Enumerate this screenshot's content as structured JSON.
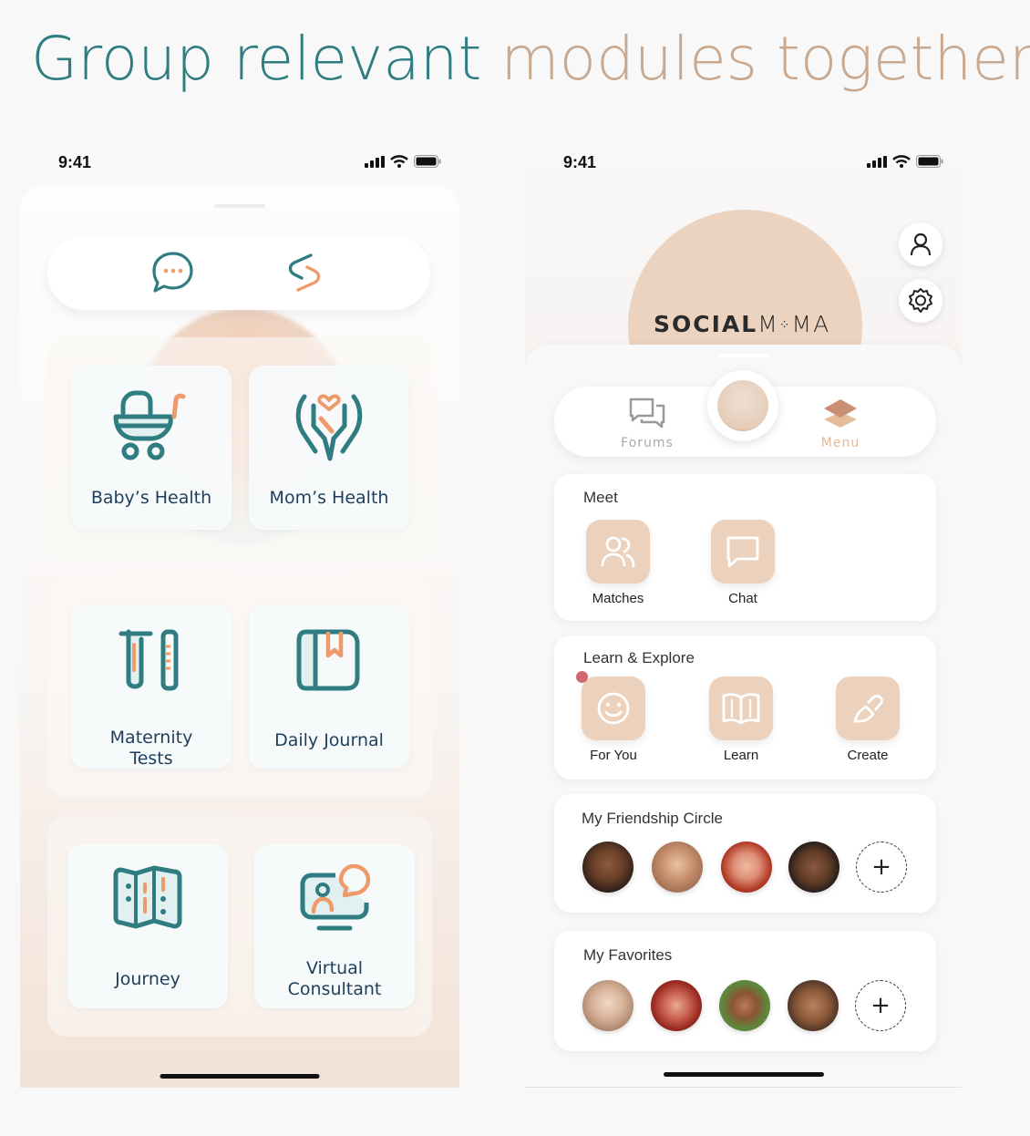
{
  "headline": {
    "part1": "Group relevant",
    "part2": "modules together"
  },
  "colors": {
    "teal": "#2f7d80",
    "tan": "#c8a98f",
    "peach": "#ecd2bd",
    "orange": "#ef9a6a",
    "navy": "#1f3e5c",
    "notification_dot": "#d06a70"
  },
  "left_phone": {
    "status_time": "9:41",
    "top_bar_icons": [
      "chat-bubble-icon",
      "swap-icon"
    ],
    "tiles": [
      {
        "label": "Baby’s Health",
        "icon": "stroller-icon"
      },
      {
        "label": "Mom’s Health",
        "icon": "hands-heart-icon"
      },
      {
        "label_line1": "Maternity",
        "label_line2": "Tests",
        "icon": "test-tubes-icon"
      },
      {
        "label": "Daily Journal",
        "icon": "journal-icon"
      },
      {
        "label": "Journey",
        "icon": "map-icon"
      },
      {
        "label_line1": "Virtual",
        "label_line2": "Consultant",
        "icon": "monitor-chat-icon"
      }
    ]
  },
  "right_phone": {
    "status_time": "9:41",
    "logo": {
      "bold": "SOCIAL",
      "light_start": "M",
      "light_end": "MA"
    },
    "tabs": [
      {
        "label": "Forums",
        "icon": "forums-icon"
      },
      {
        "label": "Menu",
        "icon": "layers-icon",
        "active": true
      }
    ],
    "sections": {
      "meet": {
        "title": "Meet",
        "items": [
          {
            "label": "Matches",
            "icon": "people-icon"
          },
          {
            "label": "Chat",
            "icon": "chat-square-icon"
          }
        ]
      },
      "learn": {
        "title": "Learn & Explore",
        "items": [
          {
            "label": "For You",
            "icon": "smiley-icon",
            "has_notification": true
          },
          {
            "label": "Learn",
            "icon": "open-book-icon"
          },
          {
            "label": "Create",
            "icon": "brush-icon"
          }
        ]
      },
      "friends": {
        "title": "My Friendship Circle",
        "add_label": "+"
      },
      "favorites": {
        "title": "My Favorites",
        "add_label": "+"
      }
    }
  }
}
